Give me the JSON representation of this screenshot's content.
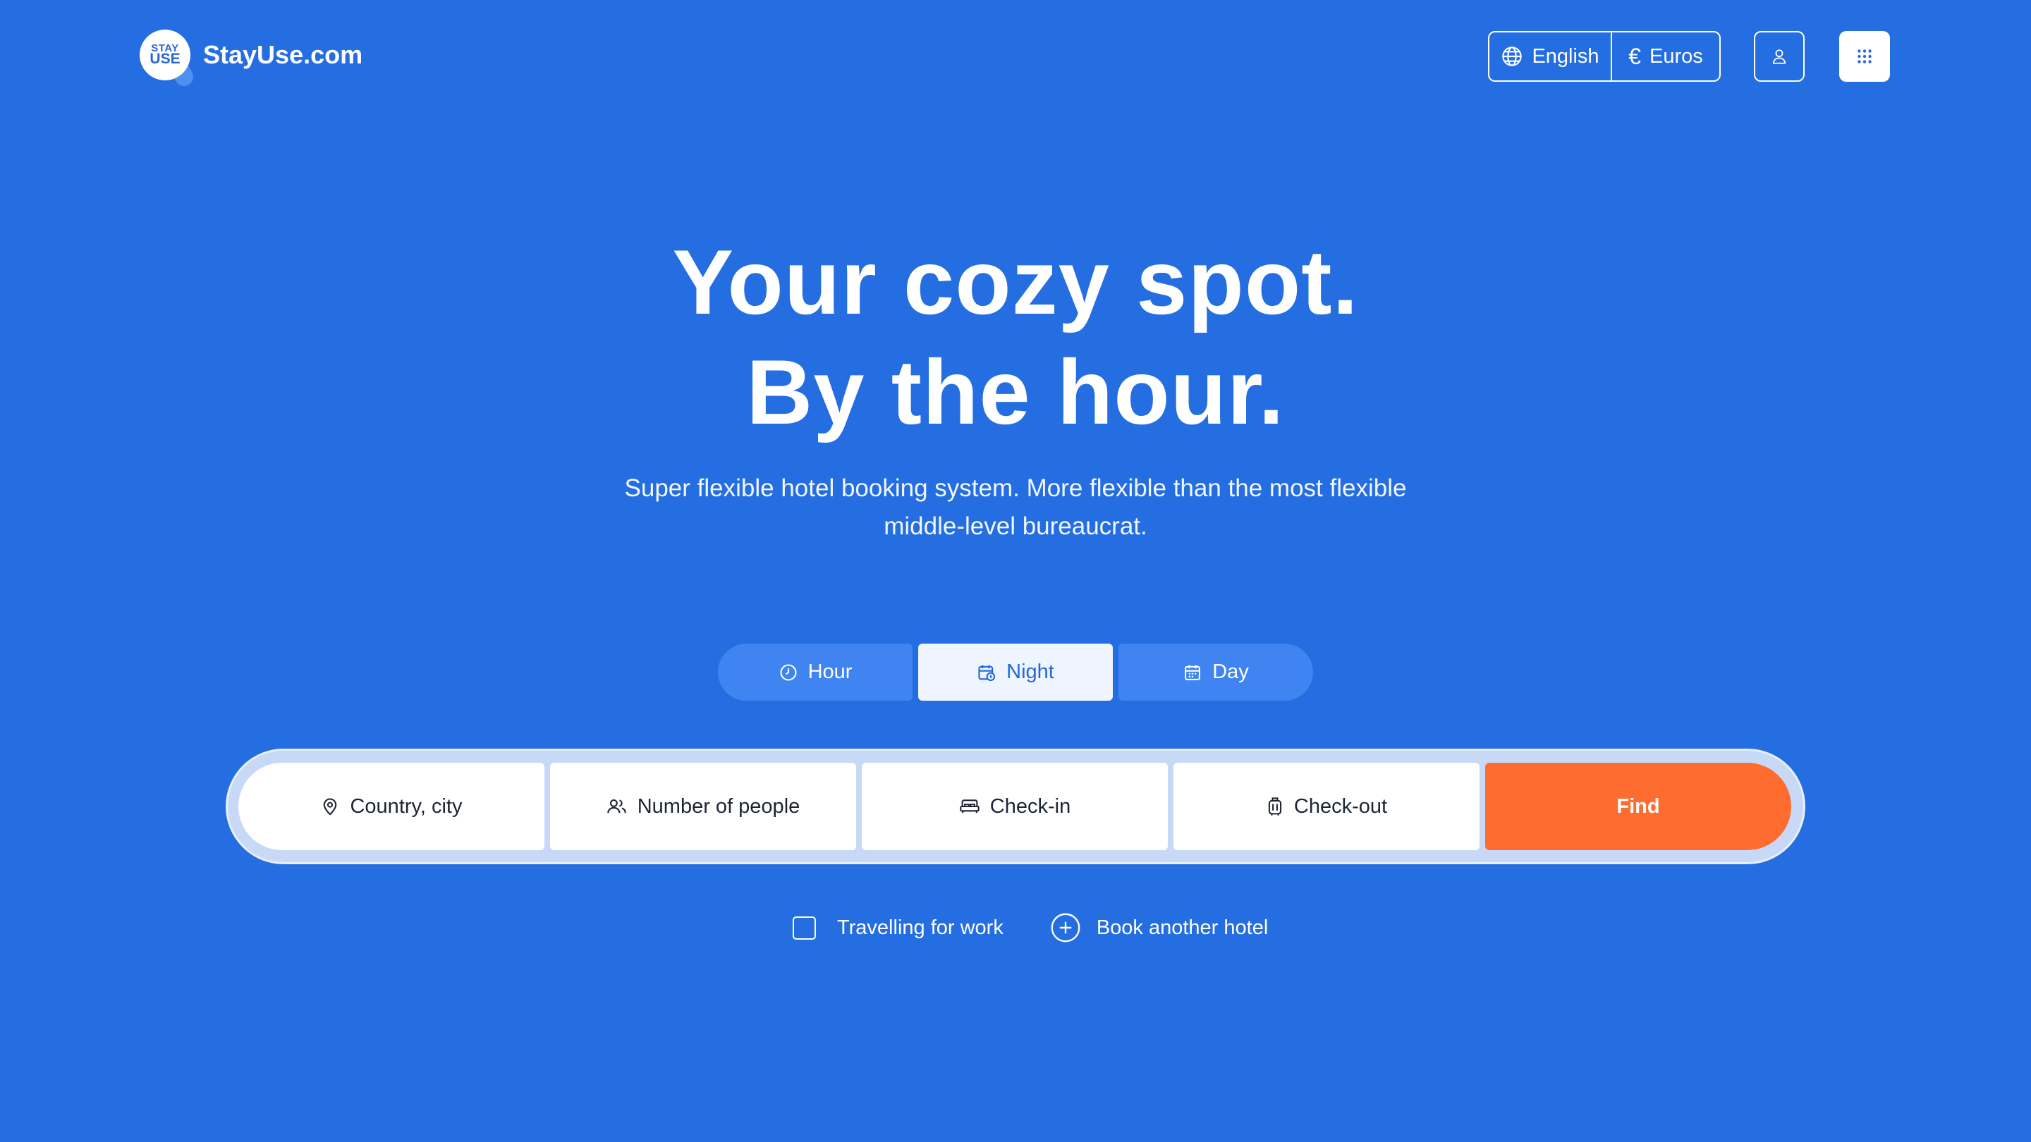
{
  "header": {
    "logo_badge_top": "STAY",
    "logo_badge_bottom": "USE",
    "logo_text": "StayUse.com",
    "language": {
      "icon": "globe-icon",
      "label": "English"
    },
    "currency": {
      "icon": "euro-icon",
      "symbol": "€",
      "label": "Euros"
    },
    "account_icon": "user-icon",
    "menu_icon": "grid-menu-icon"
  },
  "hero": {
    "title_line1": "Your cozy spot.",
    "title_line2": "By the hour.",
    "subtitle": "Super flexible hotel booking system. More flexible than the most flexible middle-level bureaucrat."
  },
  "tabs": [
    {
      "label": "Hour",
      "icon": "clock-icon",
      "active": false
    },
    {
      "label": "Night",
      "icon": "calendar-clock-icon",
      "active": true
    },
    {
      "label": "Day",
      "icon": "calendar-icon",
      "active": false
    }
  ],
  "search": {
    "location_label": "Country, city",
    "people_label": "Number of people",
    "checkin_label": "Check-in",
    "checkout_label": "Check-out",
    "find_label": "Find"
  },
  "options": {
    "work_label": "Travelling for work",
    "work_checked": false,
    "another_label": "Book another hotel"
  },
  "colors": {
    "background": "#246ee2",
    "tab": "#3f84f0",
    "tab_active": "#eff5fe",
    "find_button": "#fe6c30",
    "search_frame": "#c7d9f7"
  }
}
